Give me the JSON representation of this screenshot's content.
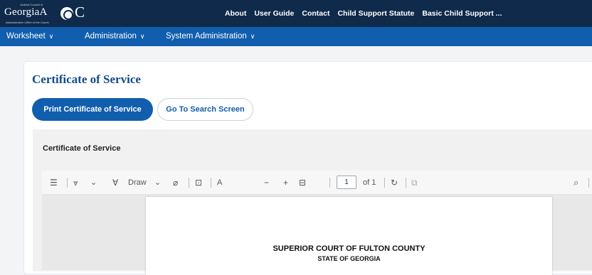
{
  "header": {
    "logo_tiny_text": "Judicial Council of",
    "logo_word": "GeorgiaA",
    "logo_c": "C",
    "logo_subtitle": "Administrative Office of the Courts",
    "links": [
      "About",
      "User Guide",
      "Contact",
      "Child Support Statute",
      "Basic Child Support ..."
    ]
  },
  "nav": {
    "items": [
      "Worksheet",
      "Administration",
      "System Administration"
    ],
    "chevron": "∨"
  },
  "main": {
    "title": "Certificate of Service",
    "print_button": "Print Certificate of Service",
    "search_button": "Go To Search Screen",
    "section_title": "Certificate of Service"
  },
  "viewer": {
    "toc_icon": "☰",
    "highlight_icon": "⩔",
    "draw_label": "Draw",
    "draw_icon": "∀",
    "dropdown_icon": "⌄",
    "eraser_icon": "⌀",
    "text_box_icon": "⊡",
    "read_aloud_icon": "A",
    "zoom_out": "−",
    "zoom_in": "+",
    "fit_icon": "⊟",
    "page_number": "1",
    "page_total": "of 1",
    "rotate_icon": "↻",
    "two_page_icon": "⧉",
    "search_icon": "⌕",
    "doc_heading": "SUPERIOR COURT OF FULTON COUNTY",
    "doc_subheading": "STATE OF GEORGIA"
  },
  "colors": {
    "top_bar": "#0f2a4a",
    "nav_bar": "#115eae",
    "title": "#0f4c8a",
    "primary_button": "#115eae"
  }
}
